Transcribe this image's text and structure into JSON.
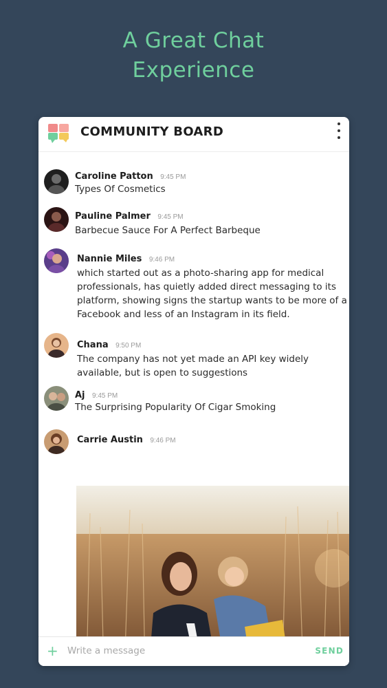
{
  "headline": {
    "line1": "A Great Chat",
    "line2": "Experience"
  },
  "board": {
    "title": "COMMUNITY BOARD"
  },
  "messages": [
    {
      "sender": "Caroline Patton",
      "time": "9:45 PM",
      "text": "Types Of Cosmetics"
    },
    {
      "sender": "Pauline Palmer",
      "time": "9:45 PM",
      "text": "Barbecue Sauce For A Perfect Barbeque"
    },
    {
      "sender": "Nannie Miles",
      "time": "9:46 PM",
      "lines": [
        "which started out as a photo-sharing app for medical",
        "professionals, has quietly added direct messaging to its",
        "platform, showing signs the startup wants to be more of a",
        "Facebook and less of an Instagram in its field."
      ]
    },
    {
      "sender": "Chana",
      "time": "9:50 PM",
      "lines": [
        "The company has not yet made an API key widely",
        "available, but is open to suggestions"
      ]
    },
    {
      "sender": "Aj",
      "time": "9:45 PM",
      "text": "The Surprising Popularity Of Cigar Smoking"
    },
    {
      "sender": "Carrie Austin",
      "time": "9:46 PM"
    }
  ],
  "composer": {
    "plus": "+",
    "placeholder": "Write a message",
    "send": "SEND"
  },
  "colors": {
    "background": "#34465a",
    "accent": "#6fcf9d",
    "card": "#ffffff"
  },
  "icons": {
    "logo": "chat-bubbles-logo-icon",
    "menu": "more-vertical-icon",
    "add": "plus-icon"
  }
}
